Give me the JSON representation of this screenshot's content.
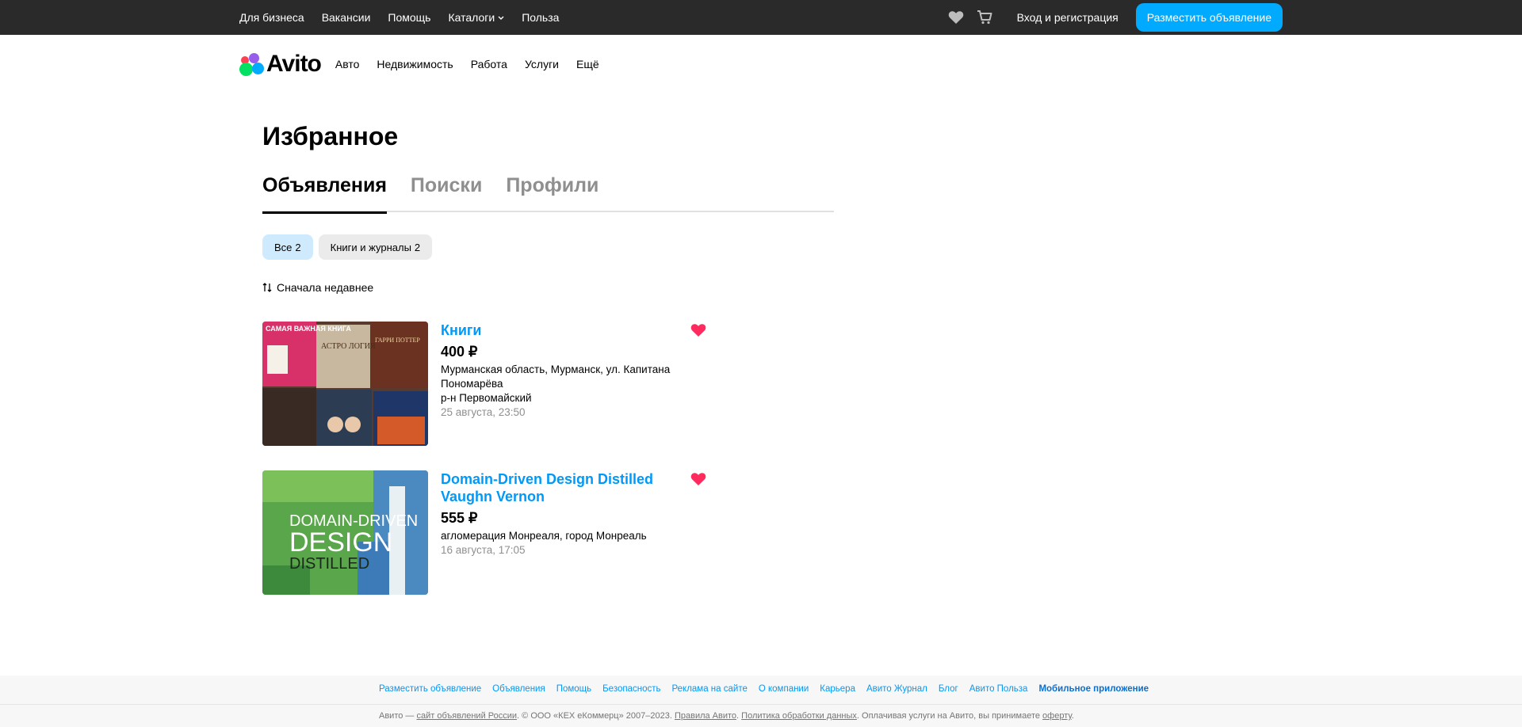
{
  "topbar": {
    "links": [
      "Для бизнеса",
      "Вакансии",
      "Помощь",
      "Каталоги",
      "Польза"
    ],
    "login": "Вход и регистрация",
    "post_button": "Разместить объявление",
    "icons": [
      "heart-icon",
      "cart-icon",
      "chevron-down-icon"
    ]
  },
  "header": {
    "logo": "Avito",
    "nav": [
      "Авто",
      "Недвижимость",
      "Работа",
      "Услуги",
      "Ещё"
    ]
  },
  "page": {
    "title": "Избранное",
    "tabs": [
      "Объявления",
      "Поиски",
      "Профили"
    ],
    "chips": [
      {
        "label": "Все",
        "count": "2"
      },
      {
        "label": "Книги и журналы",
        "count": "2"
      }
    ],
    "sort": "Сначала недавнее"
  },
  "items": [
    {
      "title": "Книги",
      "price": "400 ₽",
      "address": "Мурманская область, Мурманск, ул. Капитана Пономарёва",
      "district": "р-н Первомайский",
      "date": "25 августа, 23:50",
      "image_text": [
        "САМАЯ ВАЖНАЯ КНИГА",
        "АСТРО ЛОГИЯ",
        "ГАРРИ ПОТТЕР"
      ]
    },
    {
      "title": "Domain-Driven Design Distilled Vaughn Vernon",
      "price": "555 ₽",
      "address": "агломерация Монреаля, город Монреаль",
      "date": "16 августа, 17:05",
      "image_text": [
        "DOMAIN-DRIVEN",
        "DESIGN",
        "DISTILLED"
      ]
    }
  ],
  "footer": {
    "links": [
      "Разместить объявление",
      "Объявления",
      "Помощь",
      "Безопасность",
      "Реклама на сайте",
      "О компании",
      "Карьера",
      "Авито Журнал",
      "Блог",
      "Авито Польза",
      "Мобильное приложение"
    ],
    "legal": {
      "p1": "Авито — ",
      "l1": "сайт объявлений России",
      "p2": ". © ООО «КЕХ еКоммерц» 2007–2023. ",
      "l2": "Правила Авито",
      "p3": ". ",
      "l3": "Политика обработки данных",
      "p4": ". Оплачивая услуги на Авито, вы принимаете ",
      "l4": "оферту",
      "p5": "."
    }
  },
  "colors": {
    "topbar_bg": "#2a2a2a",
    "accent": "#00aaff",
    "link": "#0099f7",
    "favorite": "#ff2b5e",
    "chip_active": "#cfeafd"
  }
}
